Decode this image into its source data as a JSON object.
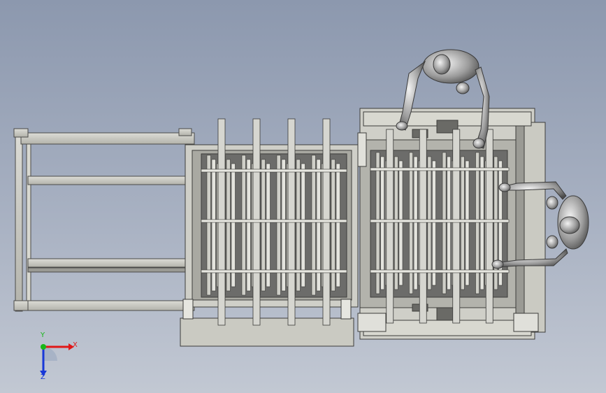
{
  "triad": {
    "x_label": "X",
    "y_label": "Y",
    "z_label": "Z",
    "x_color": "#e01818",
    "y_color": "#18b818",
    "z_color": "#1838d8"
  },
  "colors": {
    "frame": "#c5c5bd",
    "frame_dark": "#4a4a48",
    "fill_dark": "#6e6e6c",
    "figure": "#b8b8b8"
  }
}
